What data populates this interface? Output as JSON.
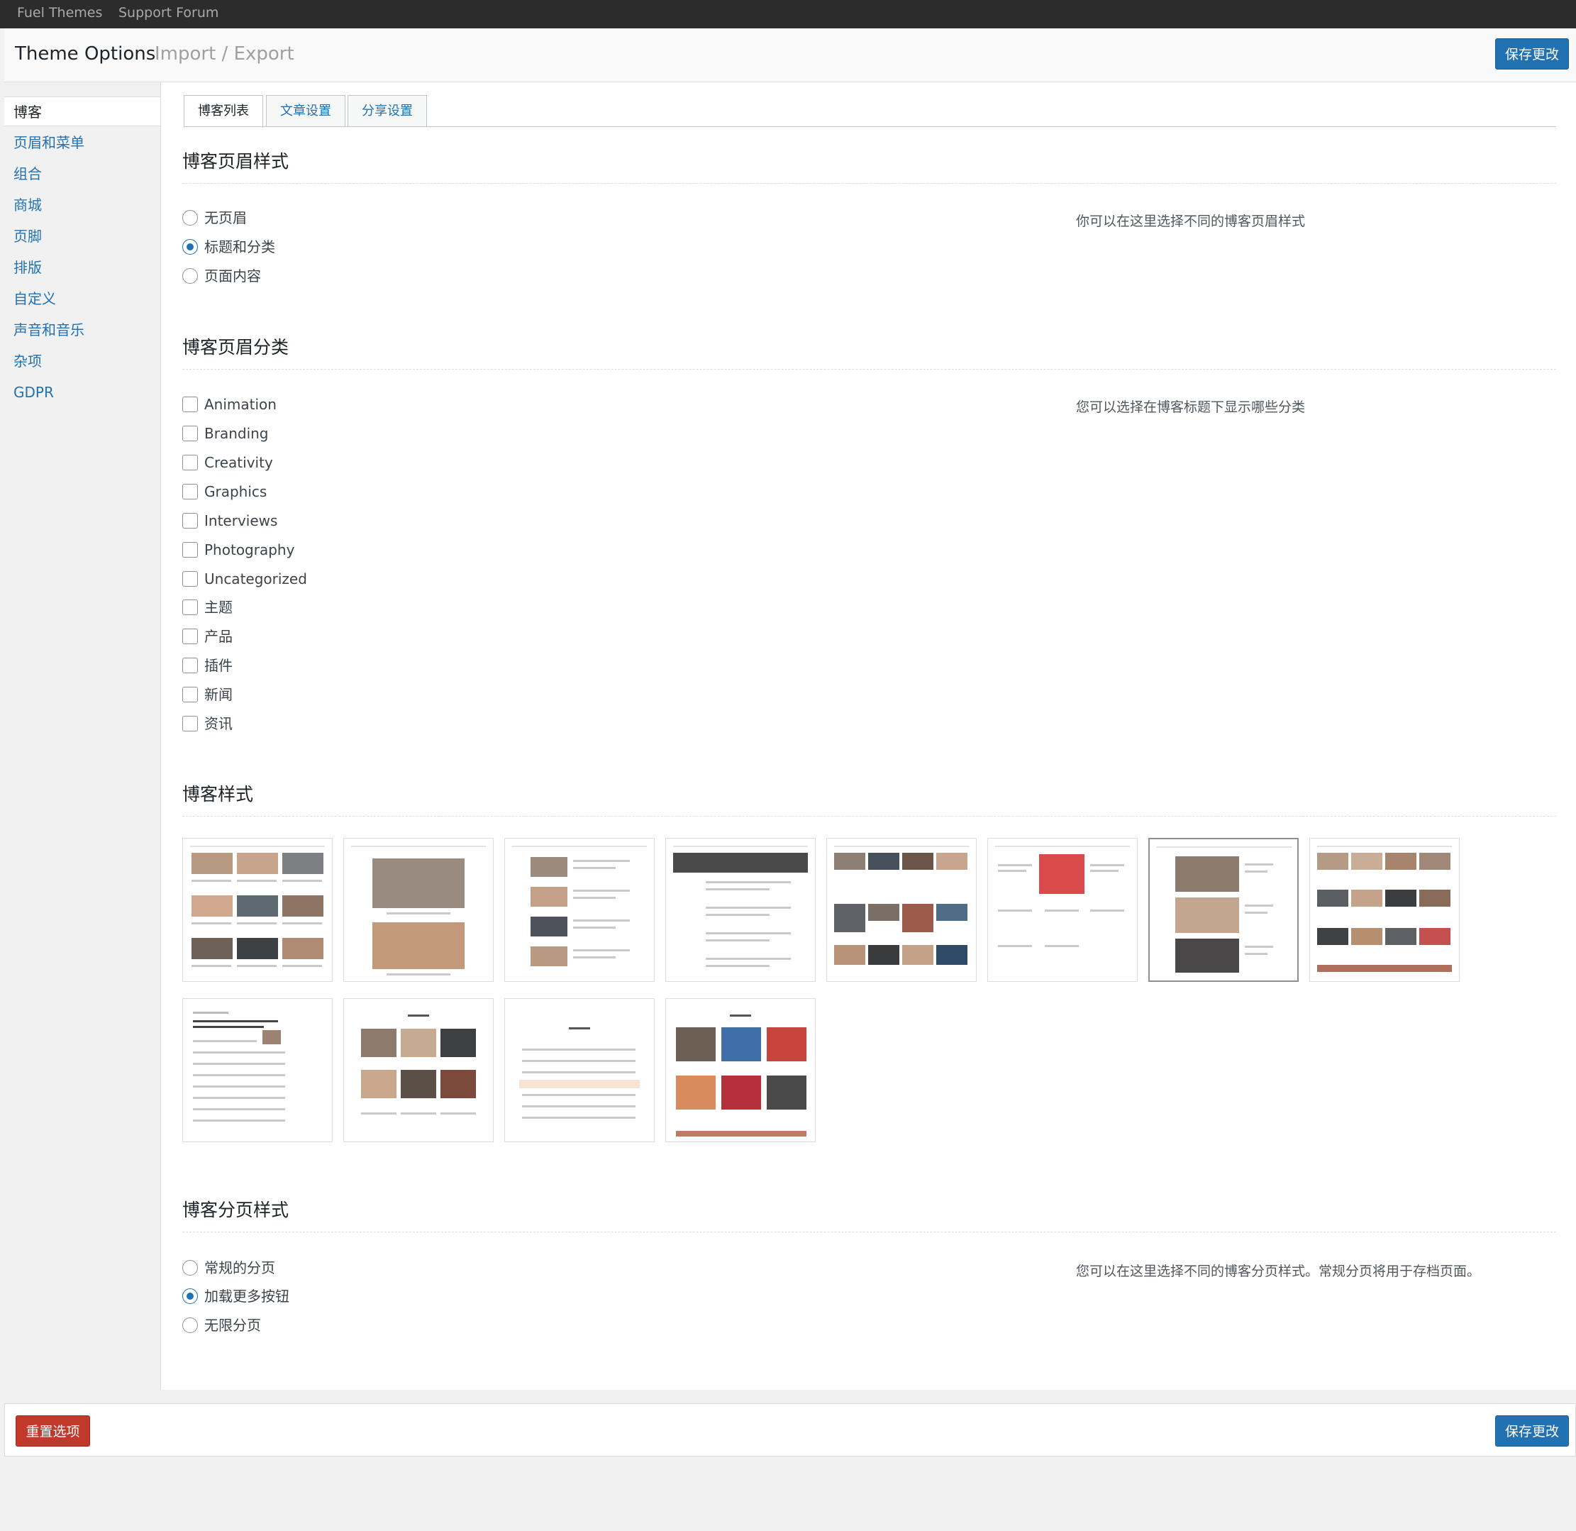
{
  "topbar": {
    "links": [
      "Fuel Themes",
      "Support Forum"
    ]
  },
  "header": {
    "title": "Theme Options",
    "subtitle": "Import / Export",
    "save_label": "保存更改"
  },
  "sidebar": {
    "items": [
      "博客",
      "页眉和菜单",
      "组合",
      "商城",
      "页脚",
      "排版",
      "自定义",
      "声音和音乐",
      "杂项",
      "GDPR"
    ]
  },
  "tabs": [
    "博客列表",
    "文章设置",
    "分享设置"
  ],
  "sections": {
    "header_style": {
      "title": "博客页眉样式",
      "options": [
        "无页眉",
        "标题和分类",
        "页面内容"
      ],
      "selected": "标题和分类",
      "description": "你可以在这里选择不同的博客页眉样式"
    },
    "header_categories": {
      "title": "博客页眉分类",
      "options": [
        "Animation",
        "Branding",
        "Creativity",
        "Graphics",
        "Interviews",
        "Photography",
        "Uncategorized",
        "主题",
        "产品",
        "插件",
        "新闻",
        "资讯"
      ],
      "description": "您可以选择在博客标题下显示哪些分类"
    },
    "blog_style": {
      "title": "博客样式",
      "selected_index": 6
    },
    "pagination": {
      "title": "博客分页样式",
      "options": [
        "常规的分页",
        "加载更多按钮",
        "无限分页"
      ],
      "selected": "加载更多按钮",
      "description": "您可以在这里选择不同的博客分页样式。常规分页将用于存档页面。"
    }
  },
  "footer": {
    "reset_label": "重置选项",
    "save_label": "保存更改"
  },
  "colors": {
    "accent": "#2271b1",
    "danger": "#c0392b",
    "topbar": "#2c2c2c"
  }
}
